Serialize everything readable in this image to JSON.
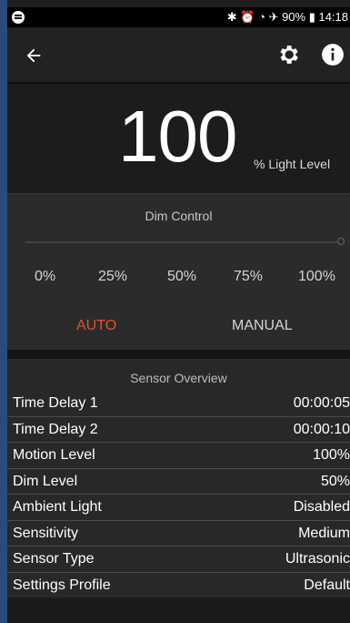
{
  "status_bar": {
    "right_text": "✱ ⏰ ◔ ✈ 90% ▮ 14:18"
  },
  "toolbar": {
    "back_icon": "arrow-left-icon",
    "settings_icon": "gear-icon",
    "info_icon": "info-icon"
  },
  "light_level": {
    "value": "100",
    "unit": "% Light Level"
  },
  "dim_control": {
    "title": "Dim Control",
    "ticks": [
      "0%",
      "25%",
      "50%",
      "75%",
      "100%"
    ],
    "slider_value_percent": 100,
    "modes": {
      "auto": "AUTO",
      "manual": "MANUAL"
    },
    "active_mode_color": "#e0522e"
  },
  "sensor_overview": {
    "title": "Sensor Overview",
    "rows": [
      {
        "label": "Time Delay 1",
        "value": "00:00:05"
      },
      {
        "label": "Time Delay 2",
        "value": "00:00:10"
      },
      {
        "label": "Motion Level",
        "value": "100%"
      },
      {
        "label": "Dim Level",
        "value": "50%"
      },
      {
        "label": "Ambient Light",
        "value": "Disabled"
      },
      {
        "label": "Sensitivity",
        "value": "Medium"
      },
      {
        "label": "Sensor Type",
        "value": "Ultrasonic"
      },
      {
        "label": "Settings Profile",
        "value": "Default"
      }
    ]
  }
}
